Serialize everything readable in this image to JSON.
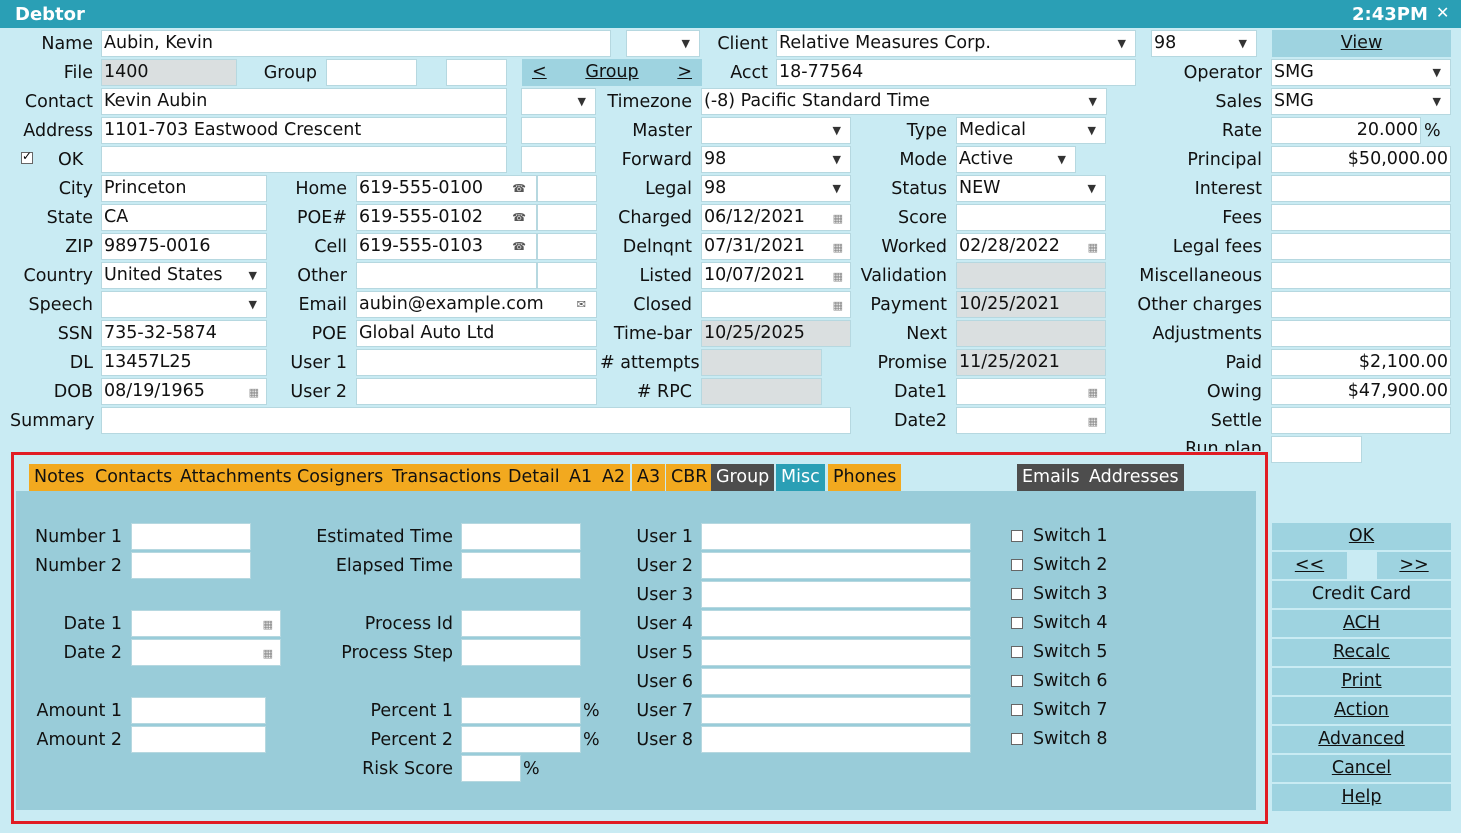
{
  "window": {
    "title": "Debtor",
    "clock": "2:43PM",
    "close": "✕"
  },
  "header": {
    "name_label": "Name",
    "name_value": "Aubin, Kevin",
    "client_label": "Client",
    "client_value": "Relative Measures Corp.",
    "client_code": "98",
    "view_button": "View",
    "file_label": "File",
    "file_value": "1400",
    "group_label": "Group",
    "group_nav": {
      "prev": "<",
      "label": "Group",
      "next": ">"
    },
    "acct_label": "Acct",
    "acct_value": "18-77564",
    "operator_label": "Operator",
    "operator_value": "SMG",
    "contact_label": "Contact",
    "contact_value": "Kevin Aubin",
    "timezone_label": "Timezone",
    "timezone_value": "(-8) Pacific Standard Time",
    "sales_label": "Sales",
    "sales_value": "SMG",
    "address_label": "Address",
    "address_value": "1101-703 Eastwood Crescent",
    "master_label": "Master",
    "master_value": "",
    "type_label": "Type",
    "type_value": "Medical",
    "rate_label": "Rate",
    "rate_value": "20.000",
    "rate_unit": "%",
    "ok_label": "OK",
    "ok_checked": true,
    "forward_label": "Forward",
    "forward_value": "98",
    "mode_label": "Mode",
    "mode_value": "Active",
    "principal_label": "Principal",
    "principal_value": "$50,000.00",
    "city_label": "City",
    "city_value": "Princeton",
    "home_label": "Home",
    "home_value": "619-555-0100",
    "legal_label": "Legal",
    "legal_value": "98",
    "status_label": "Status",
    "status_value": "NEW",
    "interest_label": "Interest",
    "interest_value": "",
    "state_label": "State",
    "state_value": "CA",
    "poe_num_label": "POE#",
    "poe_num_value": "619-555-0102",
    "charged_label": "Charged",
    "charged_value": "06/12/2021",
    "score_label": "Score",
    "score_value": "",
    "fees_label": "Fees",
    "fees_value": "",
    "zip_label": "ZIP",
    "zip_value": "98975-0016",
    "cell_label": "Cell",
    "cell_value": "619-555-0103",
    "delnqnt_label": "Delnqnt",
    "delnqnt_value": "07/31/2021",
    "worked_label": "Worked",
    "worked_value": "02/28/2022",
    "legal_fees_label": "Legal fees",
    "legal_fees_value": "",
    "country_label": "Country",
    "country_value": "United States",
    "other_label": "Other",
    "other_value": "",
    "listed_label": "Listed",
    "listed_value": "10/07/2021",
    "validation_label": "Validation",
    "validation_value": "",
    "misc_label": "Miscellaneous",
    "misc_value": "",
    "speech_label": "Speech",
    "speech_value": "",
    "email_label": "Email",
    "email_value": "aubin@example.com",
    "closed_label": "Closed",
    "closed_value": "",
    "payment_label": "Payment",
    "payment_value": "10/25/2021",
    "other_charges_label": "Other charges",
    "other_charges_value": "",
    "ssn_label": "SSN",
    "ssn_value": "735-32-5874",
    "poe_label": "POE",
    "poe_value": "Global Auto Ltd",
    "timebar_label": "Time-bar",
    "timebar_value": "10/25/2025",
    "next_label": "Next",
    "next_value": "",
    "adjustments_label": "Adjustments",
    "adjustments_value": "",
    "dl_label": "DL",
    "dl_value": "13457L25",
    "user1_label": "User 1",
    "user1_value": "",
    "attempts_label": "# attempts",
    "attempts_value": "",
    "promise_label": "Promise",
    "promise_value": "11/25/2021",
    "paid_label": "Paid",
    "paid_value": "$2,100.00",
    "dob_label": "DOB",
    "dob_value": "08/19/1965",
    "user2_label": "User 2",
    "user2_value": "",
    "rpc_label": "# RPC",
    "rpc_value": "",
    "date1_label": "Date1",
    "date1_value": "",
    "owing_label": "Owing",
    "owing_value": "$47,900.00",
    "summary_label": "Summary",
    "summary_value": "",
    "date2_label": "Date2",
    "date2_value": "",
    "settle_label": "Settle",
    "settle_value": "",
    "runplan_label": "Run plan",
    "runplan_value": ""
  },
  "tabs": [
    "Notes",
    "Contacts",
    "Attachments",
    "Cosigners",
    "Transactions",
    "Detail",
    "A1",
    "A2",
    "A3",
    "CBR",
    "Group",
    "Misc",
    "Phones"
  ],
  "tabs_right": [
    "Emails",
    "Addresses"
  ],
  "active_tab": "Misc",
  "misc": {
    "number1": "Number 1",
    "number2": "Number 2",
    "date1": "Date 1",
    "date2": "Date 2",
    "amount1": "Amount 1",
    "amount2": "Amount 2",
    "estimated_time": "Estimated Time",
    "elapsed_time": "Elapsed Time",
    "process_id": "Process Id",
    "process_step": "Process Step",
    "percent1": "Percent 1",
    "percent2": "Percent 2",
    "risk_score": "Risk Score",
    "pct": "%",
    "users": [
      "User 1",
      "User 2",
      "User 3",
      "User 4",
      "User 5",
      "User 6",
      "User 7",
      "User 8"
    ],
    "switches": [
      "Switch 1",
      "Switch 2",
      "Switch 3",
      "Switch 4",
      "Switch 5",
      "Switch 6",
      "Switch 7",
      "Switch 8"
    ]
  },
  "side": {
    "ok": "OK",
    "prev": "<<",
    "next": ">>",
    "credit_card": "Credit Card",
    "ach": "ACH",
    "recalc": "Recalc",
    "print": "Print",
    "action": "Action",
    "advanced": "Advanced",
    "cancel": "Cancel",
    "help": "Help"
  },
  "colors": {
    "title_bar": "#2a9fb5",
    "background": "#c9ebf3",
    "tab_orange": "#f2a91f",
    "tab_dark": "#4d4d4d",
    "highlight_box": "#e11c24"
  }
}
